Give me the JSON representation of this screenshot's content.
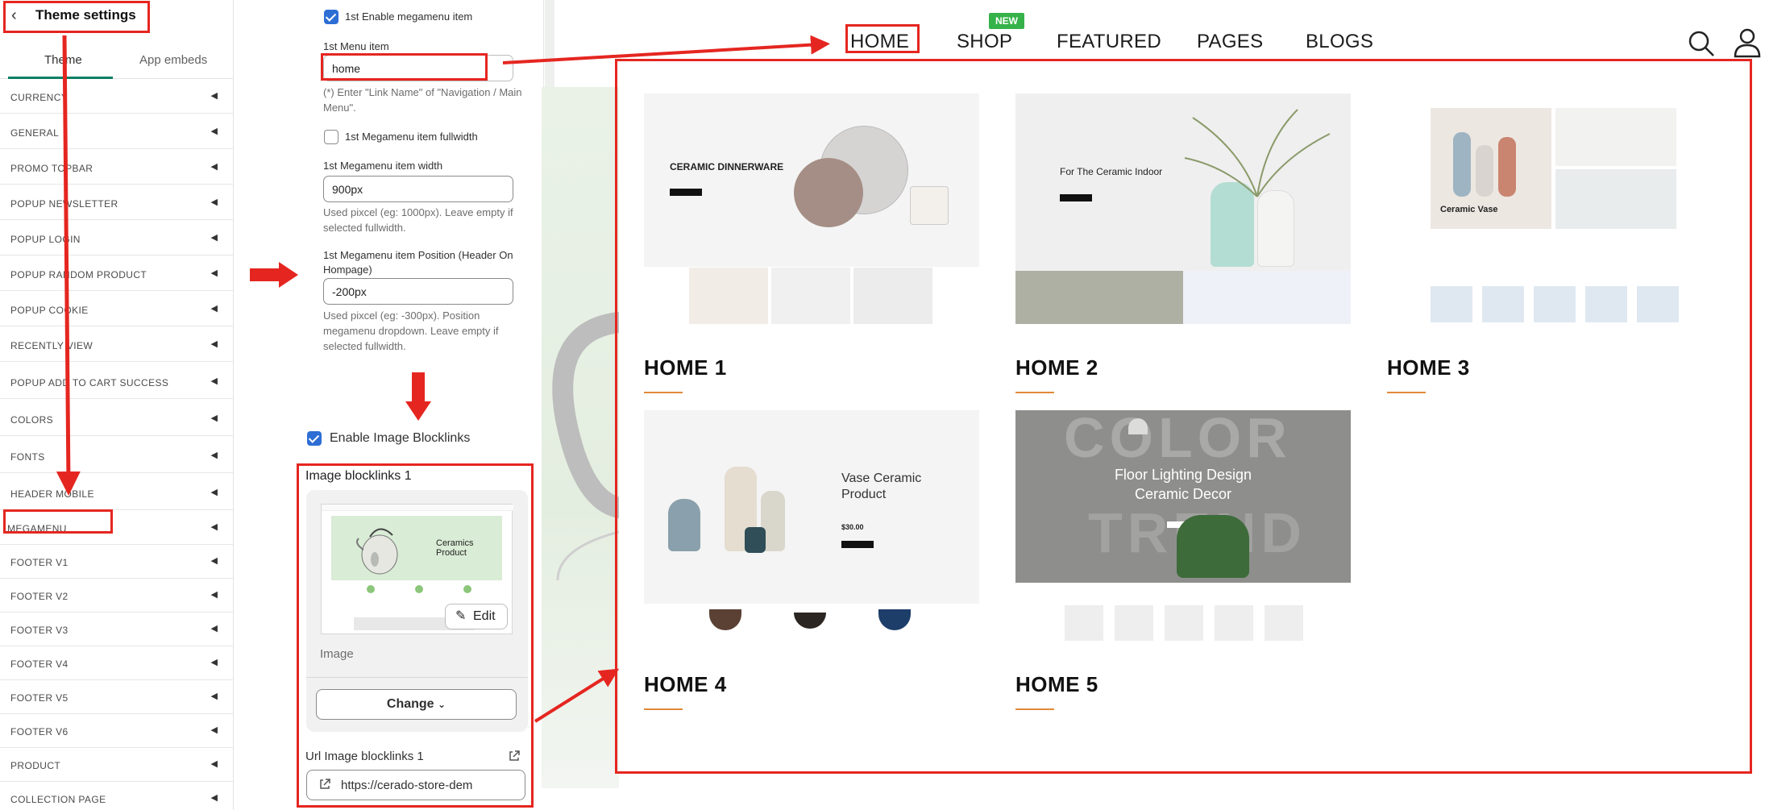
{
  "sidebar": {
    "title": "Theme settings",
    "tabs": [
      "Theme",
      "App embeds"
    ],
    "items": [
      {
        "label": "CURRENCY"
      },
      {
        "label": "GENERAL"
      },
      {
        "label": "PROMO TOPBAR"
      },
      {
        "label": "POPUP NEWSLETTER"
      },
      {
        "label": "POPUP LOGIN"
      },
      {
        "label": "POPUP RANDOM PRODUCT"
      },
      {
        "label": "POPUP COOKIE"
      },
      {
        "label": "RECENTLY VIEW"
      },
      {
        "label": "POPUP ADD TO CART SUCCESS"
      },
      {
        "label": "COLORS"
      },
      {
        "label": "FONTS"
      },
      {
        "label": "HEADER MOBILE"
      },
      {
        "label": "MEGAMENU"
      },
      {
        "label": "FOOTER V1"
      },
      {
        "label": "FOOTER V2"
      },
      {
        "label": "FOOTER V3"
      },
      {
        "label": "FOOTER V4"
      },
      {
        "label": "FOOTER V5"
      },
      {
        "label": "FOOTER V6"
      },
      {
        "label": "PRODUCT"
      },
      {
        "label": "COLLECTION PAGE"
      }
    ]
  },
  "megamenu": {
    "enable_label": "1st Enable megamenu item",
    "menu_item_label": "1st Menu item",
    "menu_item_value": "home",
    "menu_item_help": "(*) Enter \"Link Name\" of \"Navigation / Main Menu\".",
    "fullwidth_label": "1st Megamenu item fullwidth",
    "width_label": "1st Megamenu item width",
    "width_value": "900px",
    "width_help": "Used pixcel (eg: 1000px). Leave empty if selected fullwidth.",
    "position_label": "1st Megamenu item Position (Header On Hompage)",
    "position_value": "-200px",
    "position_help": "Used pixcel (eg: -300px). Position megamenu dropdown. Leave empty if selected fullwidth."
  },
  "blocklinks": {
    "enable_label": "Enable Image Blocklinks",
    "block_title": "Image blocklinks 1",
    "image_caption": "Image",
    "edit_label": "Edit",
    "change_label": "Change",
    "url_label": "Url Image blocklinks 1",
    "url_value": "https://cerado-store-dem",
    "preview_text": "Ceramics Product"
  },
  "store": {
    "nav": [
      "HOME",
      "SHOP",
      "FEATURED",
      "PAGES",
      "BLOGS"
    ],
    "new_badge": "NEW",
    "homes": [
      {
        "label": "HOME 1",
        "hero": "CERAMIC DINNERWARE"
      },
      {
        "label": "HOME 2",
        "hero": "For The Ceramic Indoor"
      },
      {
        "label": "HOME 3",
        "hero": "Ceramic Vase"
      },
      {
        "label": "HOME 4",
        "hero": "Vase Ceramic Product",
        "price": "$30.00"
      },
      {
        "label": "HOME 5",
        "hero": "Floor Lighting Design Ceramic Decor"
      }
    ]
  },
  "colors": {
    "annotation": "#e52620",
    "accent_line": "#e08a3a",
    "checkbox": "#2d6ed5",
    "new_badge": "#36b24a"
  }
}
